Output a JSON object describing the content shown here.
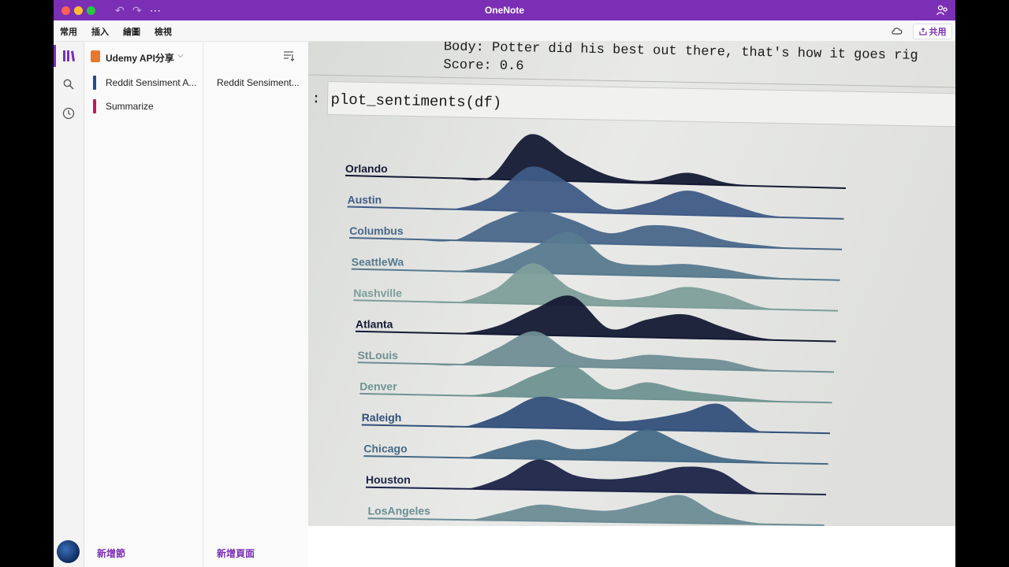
{
  "window": {
    "title": "OneNote",
    "traffic_colors": [
      "#ff5f57",
      "#febc2e",
      "#28c840"
    ],
    "accent": "#7b2fb5"
  },
  "ribbon": {
    "tabs": [
      "常用",
      "插入",
      "繪圖",
      "檢視"
    ],
    "share_label": "共用"
  },
  "notebook": {
    "title": "Udemy API分享",
    "sections": [
      {
        "label": "Reddit Sensiment A...",
        "color": "#1f4e8c",
        "selected": true
      },
      {
        "label": "Summarize",
        "color": "#c2185b",
        "selected": false
      }
    ],
    "add_section_label": "新增節"
  },
  "pages": {
    "items": [
      {
        "label": "Reddit Sensiment...",
        "selected": true
      }
    ],
    "add_page_label": "新增頁面"
  },
  "note": {
    "line1": "Body: Potter did his best out there, that's how it goes rig",
    "line2": "Score: 0.6",
    "cell_prompt": ":",
    "cell_code": "plot_sentiments(df)"
  },
  "chart_data": {
    "type": "area",
    "title": "",
    "rows": [
      {
        "label": "Orlando",
        "color": "#141a33",
        "density": [
          0,
          0,
          0.05,
          1.0,
          0.55,
          0.15,
          0.05,
          0.25,
          0.05,
          0,
          0,
          0
        ]
      },
      {
        "label": "Austin",
        "color": "#3f5b86",
        "density": [
          0,
          0,
          0.3,
          1.0,
          0.65,
          0.1,
          0.25,
          0.55,
          0.3,
          0.05,
          0,
          0
        ]
      },
      {
        "label": "Columbus",
        "color": "#49678a",
        "density": [
          0,
          0,
          0.45,
          0.75,
          0.55,
          0.25,
          0.45,
          0.4,
          0.15,
          0.05,
          0,
          0
        ]
      },
      {
        "label": "SeattleWa",
        "color": "#587a8f",
        "density": [
          0,
          0,
          0.2,
          0.6,
          1.0,
          0.35,
          0.25,
          0.3,
          0.2,
          0.05,
          0,
          0
        ]
      },
      {
        "label": "Nashville",
        "color": "#7e9e9a",
        "density": [
          0,
          0,
          0.35,
          1.0,
          0.4,
          0.15,
          0.25,
          0.5,
          0.35,
          0.05,
          0,
          0
        ]
      },
      {
        "label": "Atlanta",
        "color": "#141a33",
        "density": [
          0,
          0,
          0.2,
          0.65,
          1.0,
          0.2,
          0.45,
          0.6,
          0.3,
          0.05,
          0,
          0
        ]
      },
      {
        "label": "StLouis",
        "color": "#6f8e93",
        "density": [
          0,
          0,
          0.45,
          0.9,
          0.35,
          0.2,
          0.35,
          0.3,
          0.25,
          0.05,
          0,
          0
        ]
      },
      {
        "label": "Denver",
        "color": "#6f9491",
        "density": [
          0,
          0,
          0.15,
          0.6,
          0.85,
          0.25,
          0.45,
          0.25,
          0.15,
          0.05,
          0,
          0
        ]
      },
      {
        "label": "Raleigh",
        "color": "#33507a",
        "density": [
          0,
          0,
          0.35,
          0.85,
          0.7,
          0.25,
          0.3,
          0.5,
          0.75,
          0.05,
          0,
          0
        ]
      },
      {
        "label": "Chicago",
        "color": "#466a86",
        "density": [
          0,
          0,
          0.3,
          0.55,
          0.3,
          0.45,
          0.9,
          0.5,
          0.15,
          0.05,
          0,
          0
        ]
      },
      {
        "label": "Houston",
        "color": "#1c2448",
        "density": [
          0,
          0,
          0.35,
          0.9,
          0.45,
          0.35,
          0.5,
          0.75,
          0.65,
          0.05,
          0,
          0
        ]
      },
      {
        "label": "LosAngeles",
        "color": "#6b8c95",
        "density": [
          0,
          0,
          0.25,
          0.5,
          0.4,
          0.35,
          0.6,
          0.85,
          0.3,
          0.05,
          0,
          0
        ]
      }
    ]
  }
}
